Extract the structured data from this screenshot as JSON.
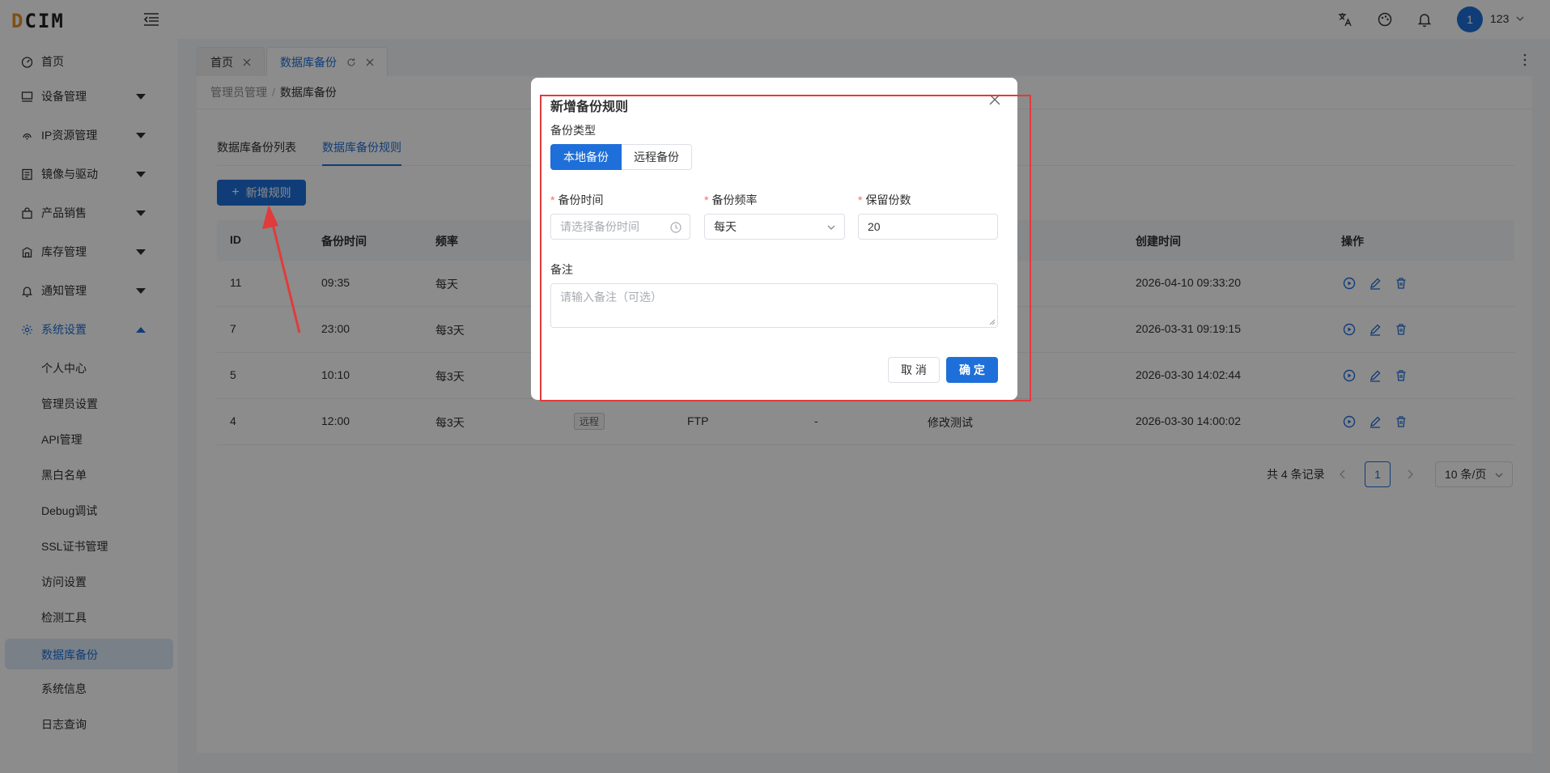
{
  "app": {
    "logo_text": "DCIM",
    "logo_first": "D",
    "logo_rest": "CIM"
  },
  "header": {
    "avatar_initial": "1",
    "user_name": "123",
    "icons": [
      "translate-icon",
      "theme-icon",
      "bell-icon"
    ]
  },
  "sidebar": {
    "items": [
      {
        "label": "首页",
        "icon": "dashboard-icon"
      },
      {
        "label": "设备管理",
        "icon": "monitor-icon"
      },
      {
        "label": "IP资源管理",
        "icon": "network-icon"
      },
      {
        "label": "镜像与驱动",
        "icon": "disk-icon"
      },
      {
        "label": "产品销售",
        "icon": "bag-icon"
      },
      {
        "label": "库存管理",
        "icon": "warehouse-icon"
      },
      {
        "label": "通知管理",
        "icon": "bell-icon"
      },
      {
        "label": "系统设置",
        "icon": "gear-icon"
      }
    ],
    "sub_items": [
      {
        "label": "个人中心"
      },
      {
        "label": "管理员设置"
      },
      {
        "label": "API管理"
      },
      {
        "label": "黑白名单"
      },
      {
        "label": "Debug调试"
      },
      {
        "label": "SSL证书管理"
      },
      {
        "label": "访问设置"
      },
      {
        "label": "检测工具"
      },
      {
        "label": "数据库备份"
      },
      {
        "label": "系统信息"
      },
      {
        "label": "日志查询"
      }
    ]
  },
  "tabs": [
    {
      "label": "首页"
    },
    {
      "label": "数据库备份"
    }
  ],
  "breadcrumb": {
    "parent": "管理员管理",
    "separator": "/",
    "current": "数据库备份"
  },
  "subtabs": {
    "list": "数据库备份列表",
    "rules": "数据库备份规则"
  },
  "add_button": {
    "plus": "+",
    "label": "新增规则"
  },
  "table": {
    "headers": [
      "ID",
      "备份时间",
      "频率",
      "创建时间",
      "操作"
    ],
    "rows": [
      {
        "id": "11",
        "time": "09:35",
        "freq": "每天",
        "created": "2026-04-10 09:33:20"
      },
      {
        "id": "7",
        "time": "23:00",
        "freq": "每3天",
        "created": "2026-03-31 09:19:15"
      },
      {
        "id": "5",
        "time": "10:10",
        "freq": "每3天",
        "created": "2026-03-30 14:02:44"
      },
      {
        "id": "4",
        "time": "12:00",
        "freq": "每3天",
        "type_tag": "远程",
        "protocol": "FTP",
        "extra": "-",
        "remark": "修改测试",
        "created": "2026-03-30 14:00:02"
      }
    ]
  },
  "pagination": {
    "total": "共 4 条记录",
    "current_page": "1",
    "page_size": "10 条/页"
  },
  "dialog": {
    "title": "新增备份规则",
    "type_label": "备份类型",
    "type_local": "本地备份",
    "type_remote": "远程备份",
    "required_mark": "*",
    "time_label": "备份时间",
    "time_placeholder": "请选择备份时间",
    "freq_label": "备份频率",
    "freq_value": "每天",
    "keep_label": "保留份数",
    "keep_value": "20",
    "remark_label": "备注",
    "remark_placeholder": "请输入备注（可选）",
    "cancel": "取 消",
    "confirm": "确 定"
  },
  "colors": {
    "primary": "#1e6fd9",
    "annotation": "#e23b3b",
    "required": "#f56c6c"
  }
}
